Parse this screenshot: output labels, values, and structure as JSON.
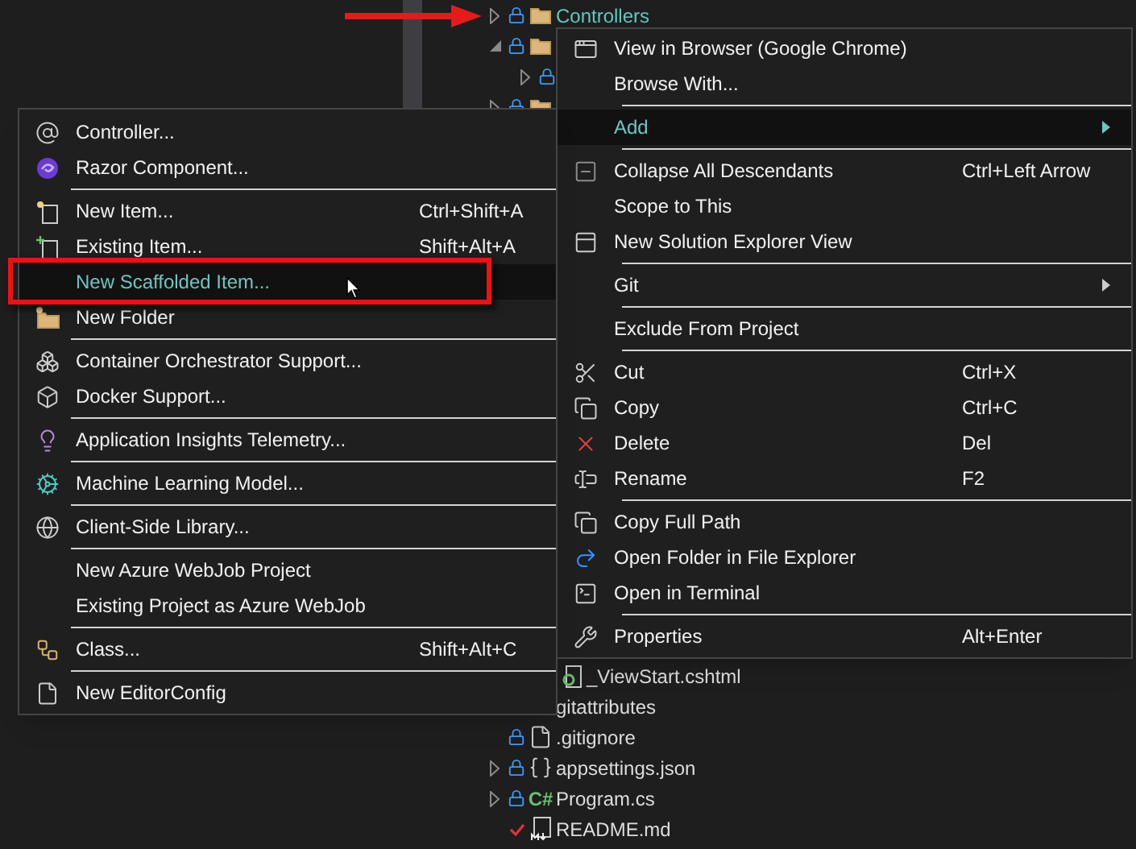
{
  "tree_top": [
    {
      "label": "Controllers",
      "kind": "folder",
      "expanded": false,
      "locked": true,
      "pointed": true
    },
    {
      "kind": "folder",
      "expanded": true,
      "locked": true,
      "children": [
        {
          "expanded": false,
          "locked": true
        }
      ]
    },
    {
      "kind": "folder",
      "expanded": false,
      "locked": true
    }
  ],
  "tree_bottom": [
    {
      "children": [
        {
          "label": "_ViewStart.cshtml",
          "kind": "razor"
        }
      ]
    },
    {
      "label": "gitattributes"
    },
    {
      "label": ".gitignore",
      "kind": "file",
      "locked": true
    },
    {
      "label": "appsettings.json",
      "kind": "json",
      "expanded": false,
      "locked": true
    },
    {
      "label": "Program.cs",
      "kind": "csharp",
      "icon_text": "C#",
      "expanded": false,
      "locked": true
    },
    {
      "label": "README.md",
      "kind": "markdown",
      "pending_edit": true
    }
  ],
  "add_submenu": {
    "items": [
      {
        "kind": "item",
        "label": "Controller...",
        "selected": false
      },
      {
        "kind": "item",
        "label": "Razor Component...",
        "selected": false
      },
      {
        "kind": "separator"
      },
      {
        "kind": "item",
        "label": "New Item...",
        "shortcut": "Ctrl+Shift+A",
        "selected": false
      },
      {
        "kind": "item",
        "label": "Existing Item...",
        "shortcut": "Shift+Alt+A",
        "selected": false
      },
      {
        "kind": "item",
        "label": "New Scaffolded Item...",
        "selected": true,
        "outlined": true
      },
      {
        "kind": "item",
        "label": "New Folder",
        "selected": false
      },
      {
        "kind": "separator"
      },
      {
        "kind": "item",
        "label": "Container Orchestrator Support...",
        "selected": false
      },
      {
        "kind": "item",
        "label": "Docker Support...",
        "selected": false
      },
      {
        "kind": "separator"
      },
      {
        "kind": "item",
        "label": "Application Insights Telemetry...",
        "selected": false
      },
      {
        "kind": "separator"
      },
      {
        "kind": "item",
        "label": "Machine Learning Model...",
        "selected": false
      },
      {
        "kind": "separator"
      },
      {
        "kind": "item",
        "label": "Client-Side Library...",
        "selected": false
      },
      {
        "kind": "separator"
      },
      {
        "kind": "item",
        "label": "New Azure WebJob Project",
        "selected": false
      },
      {
        "kind": "item",
        "label": "Existing Project as Azure WebJob",
        "selected": false
      },
      {
        "kind": "separator"
      },
      {
        "kind": "item",
        "label": "Class...",
        "shortcut": "Shift+Alt+C",
        "selected": false
      },
      {
        "kind": "separator"
      },
      {
        "kind": "item",
        "label": "New EditorConfig",
        "selected": false
      }
    ]
  },
  "context_menu": {
    "items": [
      {
        "kind": "item",
        "label": "View in Browser (Google Chrome)",
        "selected": false
      },
      {
        "kind": "item",
        "label": "Browse With...",
        "selected": false
      },
      {
        "kind": "separator"
      },
      {
        "kind": "item",
        "label": "Add",
        "submenu": true,
        "selected": true
      },
      {
        "kind": "separator"
      },
      {
        "kind": "item",
        "label": "Collapse All Descendants",
        "shortcut": "Ctrl+Left Arrow",
        "selected": false
      },
      {
        "kind": "item",
        "label": "Scope to This",
        "selected": false
      },
      {
        "kind": "item",
        "label": "New Solution Explorer View",
        "selected": false
      },
      {
        "kind": "separator"
      },
      {
        "kind": "item",
        "label": "Git",
        "submenu": true,
        "selected": false
      },
      {
        "kind": "separator"
      },
      {
        "kind": "item",
        "label": "Exclude From Project",
        "selected": false
      },
      {
        "kind": "separator"
      },
      {
        "kind": "item",
        "label": "Cut",
        "shortcut": "Ctrl+X",
        "selected": false
      },
      {
        "kind": "item",
        "label": "Copy",
        "shortcut": "Ctrl+C",
        "selected": false
      },
      {
        "kind": "item",
        "label": "Delete",
        "shortcut": "Del",
        "selected": false
      },
      {
        "kind": "item",
        "label": "Rename",
        "shortcut": "F2",
        "selected": false
      },
      {
        "kind": "separator"
      },
      {
        "kind": "item",
        "label": "Copy Full Path",
        "selected": false
      },
      {
        "kind": "item",
        "label": "Open Folder in File Explorer",
        "selected": false
      },
      {
        "kind": "item",
        "label": "Open in Terminal",
        "selected": false
      },
      {
        "kind": "separator"
      },
      {
        "kind": "item",
        "label": "Properties",
        "shortcut": "Alt+Enter",
        "selected": false
      }
    ]
  }
}
